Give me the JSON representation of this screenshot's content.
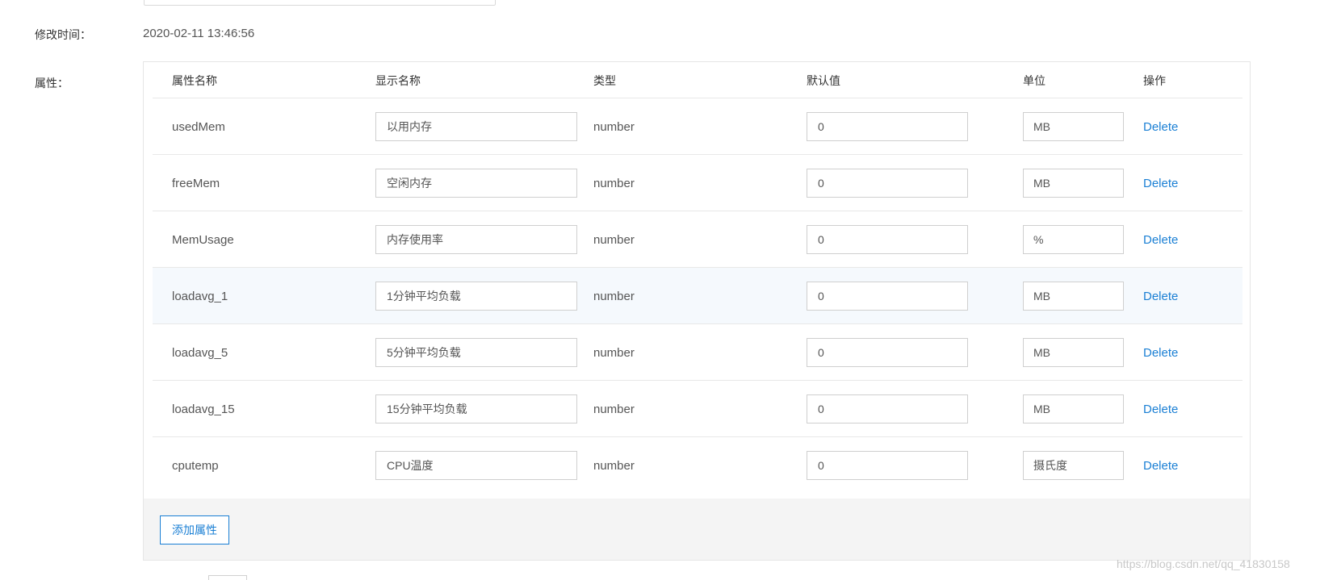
{
  "modified_time": {
    "label": "修改时间：",
    "value": "2020-02-11 13:46:56"
  },
  "properties": {
    "label": "属性：",
    "columns": {
      "name": "属性名称",
      "display": "显示名称",
      "type": "类型",
      "default": "默认值",
      "unit": "单位",
      "action": "操作"
    },
    "rows": [
      {
        "name": "usedMem",
        "display": "以用内存",
        "type": "number",
        "default": "0",
        "unit": "MB",
        "action": "Delete"
      },
      {
        "name": "freeMem",
        "display": "空闲内存",
        "type": "number",
        "default": "0",
        "unit": "MB",
        "action": "Delete"
      },
      {
        "name": "MemUsage",
        "display": "内存使用率",
        "type": "number",
        "default": "0",
        "unit": "%",
        "action": "Delete"
      },
      {
        "name": "loadavg_1",
        "display": "1分钟平均负载",
        "type": "number",
        "default": "0",
        "unit": "MB",
        "action": "Delete"
      },
      {
        "name": "loadavg_5",
        "display": "5分钟平均负载",
        "type": "number",
        "default": "0",
        "unit": "MB",
        "action": "Delete"
      },
      {
        "name": "loadavg_15",
        "display": "15分钟平均负载",
        "type": "number",
        "default": "0",
        "unit": "MB",
        "action": "Delete"
      },
      {
        "name": "cputemp",
        "display": "CPU温度",
        "type": "number",
        "default": "0",
        "unit": "摄氏度",
        "action": "Delete"
      }
    ],
    "add_button_label": "添加属性"
  },
  "watermark": "https://blog.csdn.net/qq_41830158",
  "colors": {
    "link": "#1a7fd4",
    "row_highlight": "#f5f9fd",
    "footer_bg": "#f4f4f4"
  }
}
